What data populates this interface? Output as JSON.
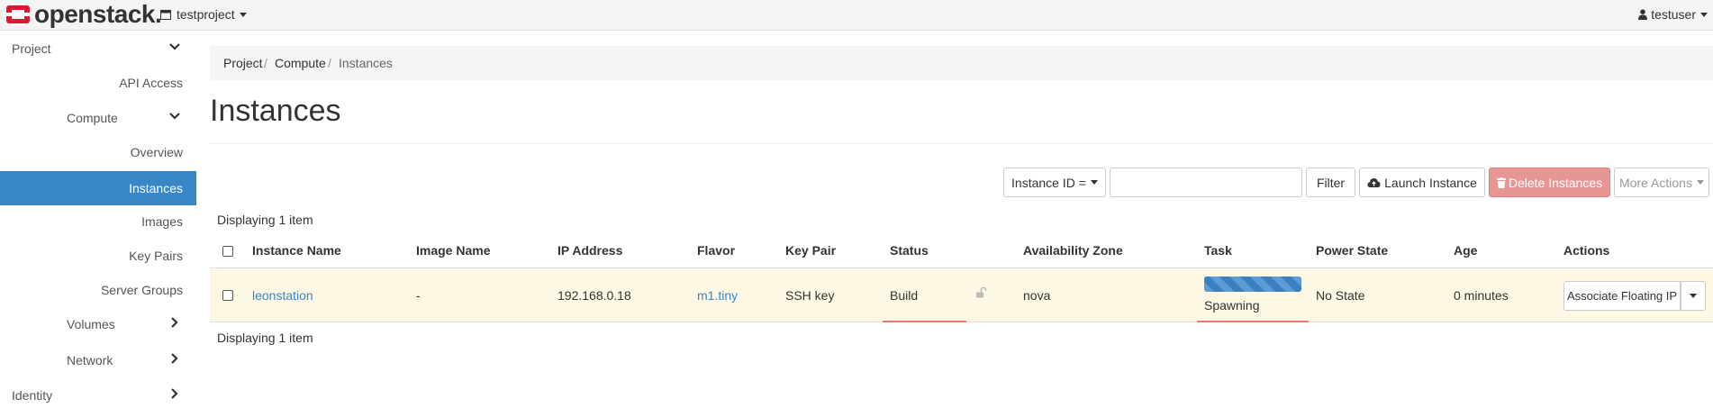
{
  "navbar": {
    "brand": "openstack.",
    "project": "testproject",
    "user": "testuser"
  },
  "sidebar": {
    "items": [
      {
        "label": "Project"
      },
      {
        "label": "API Access"
      },
      {
        "label": "Compute"
      },
      {
        "label": "Overview"
      },
      {
        "label": "Instances"
      },
      {
        "label": "Images"
      },
      {
        "label": "Key Pairs"
      },
      {
        "label": "Server Groups"
      },
      {
        "label": "Volumes"
      },
      {
        "label": "Network"
      },
      {
        "label": "Identity"
      }
    ]
  },
  "breadcrumb": [
    "Project",
    "Compute",
    "Instances"
  ],
  "page_title": "Instances",
  "toolbar": {
    "filter_field": "Instance ID =",
    "filter_value": "",
    "filter_button": "Filter",
    "launch_button": "Launch Instance",
    "delete_button": "Delete Instances",
    "more_button": "More Actions"
  },
  "displaying_top": "Displaying 1 item",
  "displaying_bottom": "Displaying 1 item",
  "table": {
    "headers": [
      "Instance Name",
      "Image Name",
      "IP Address",
      "Flavor",
      "Key Pair",
      "Status",
      "Availability Zone",
      "Task",
      "Power State",
      "Age",
      "Actions"
    ],
    "rows": [
      {
        "instance_name": "leonstation",
        "image_name": "-",
        "ip_address": "192.168.0.18",
        "flavor": "m1.tiny",
        "key_pair": "SSH key",
        "status": "Build",
        "availability_zone": "nova",
        "task": "Spawning",
        "power_state": "No State",
        "age": "0 minutes",
        "action": "Associate Floating IP"
      }
    ]
  },
  "colors": {
    "accent": "#3a87c8",
    "danger": "#e89694",
    "row_highlight": "#fcf8e3",
    "brand_red": "#da1a32"
  }
}
